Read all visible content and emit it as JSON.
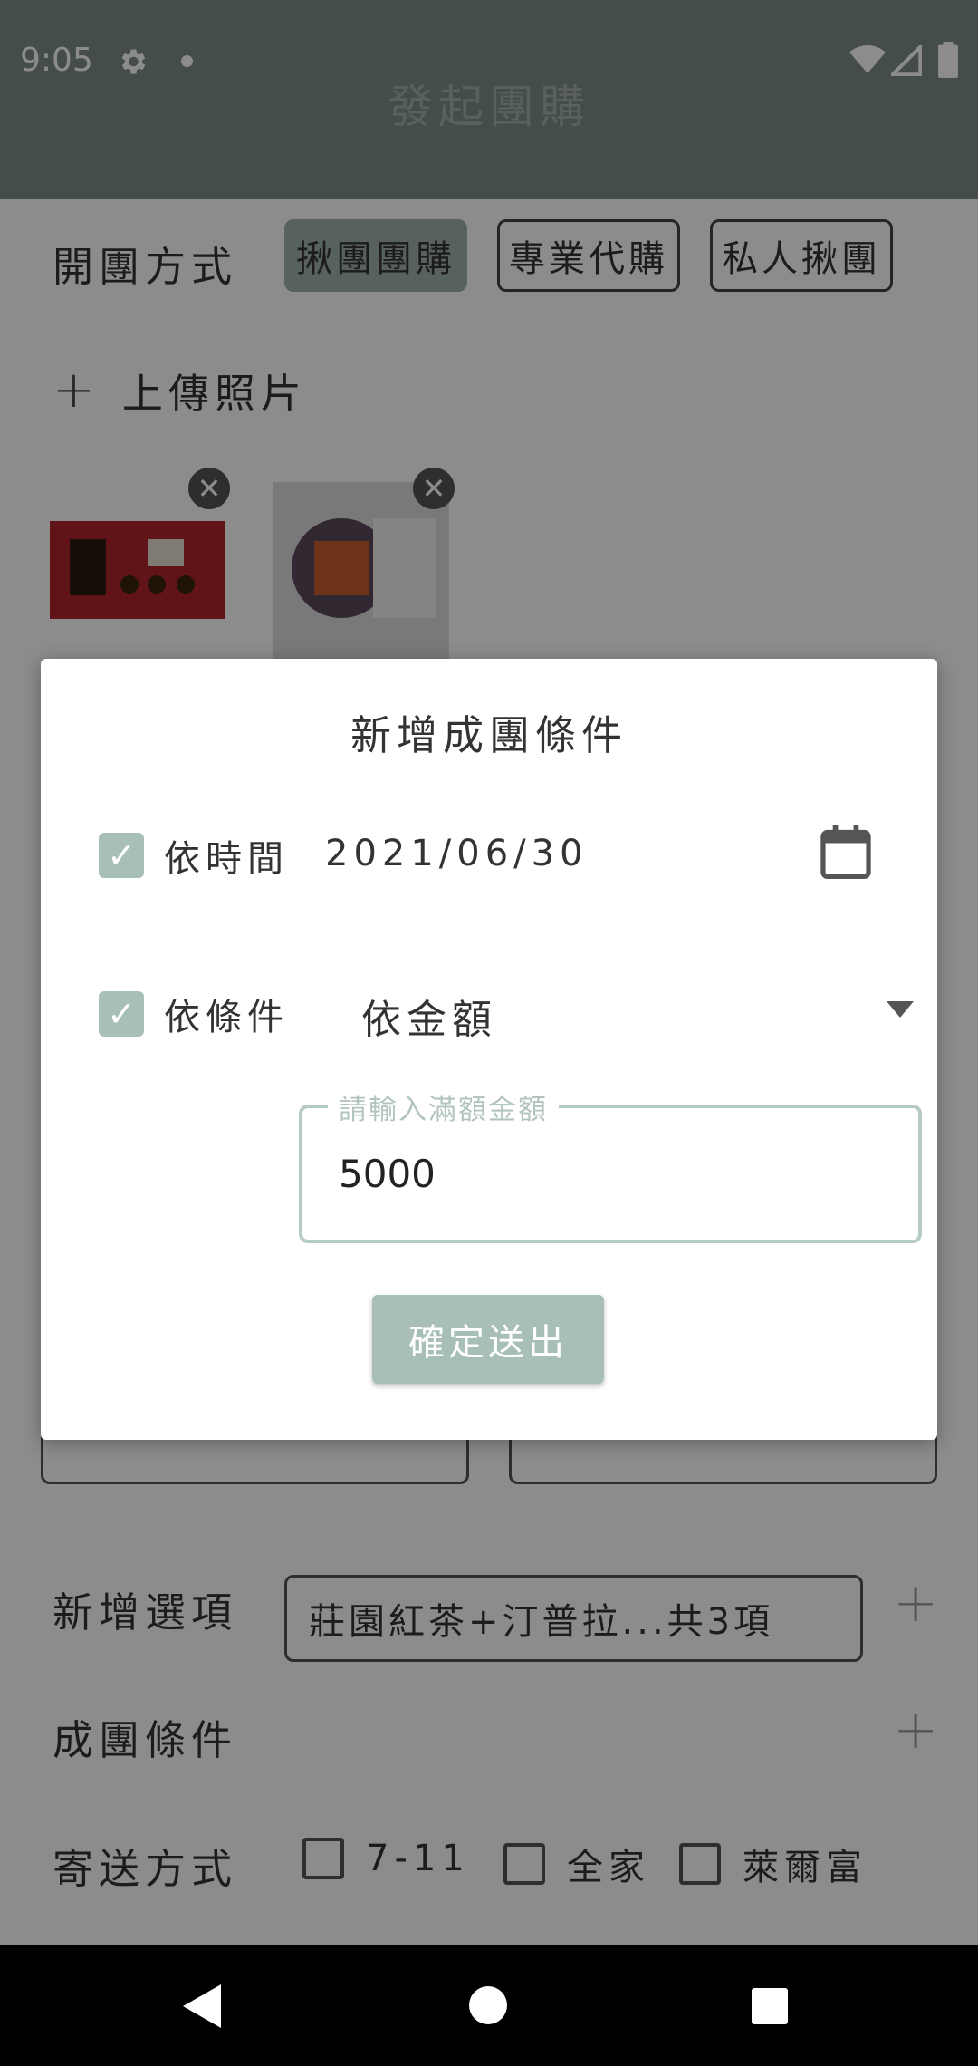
{
  "status_bar": {
    "time": "9:05"
  },
  "app_bar": {
    "title": "發起團購"
  },
  "form": {
    "open_method_label": "開團方式",
    "open_methods": [
      "揪團團購",
      "專業代購",
      "私人揪團"
    ],
    "upload_label": "上傳照片",
    "options_label": "新增選項",
    "options_value": "莊園紅茶+汀普拉...共3項",
    "condition_label": "成團條件",
    "shipping_label": "寄送方式",
    "shipping_options": [
      "7-11",
      "全家",
      "萊爾富"
    ]
  },
  "dialog": {
    "title": "新增成團條件",
    "by_time": {
      "label": "依時間",
      "date": "2021/06/30",
      "checked": true
    },
    "by_condition": {
      "label": "依條件",
      "selected": "依金額",
      "checked": true
    },
    "amount_field": {
      "label": "請輸入滿額金額",
      "value": "5000"
    },
    "submit_label": "確定送出"
  },
  "icons": {
    "settings": "gear-icon",
    "dot": "notification-dot-icon",
    "wifi": "wifi-icon",
    "signal": "signal-icon",
    "battery": "battery-icon",
    "calendar": "calendar-icon",
    "dropdown": "chevron-down-icon",
    "back": "back-icon",
    "home": "home-icon",
    "recents": "recents-icon"
  },
  "colors": {
    "accent": "#a8bfb8",
    "app_bar": "#7d8c88"
  }
}
